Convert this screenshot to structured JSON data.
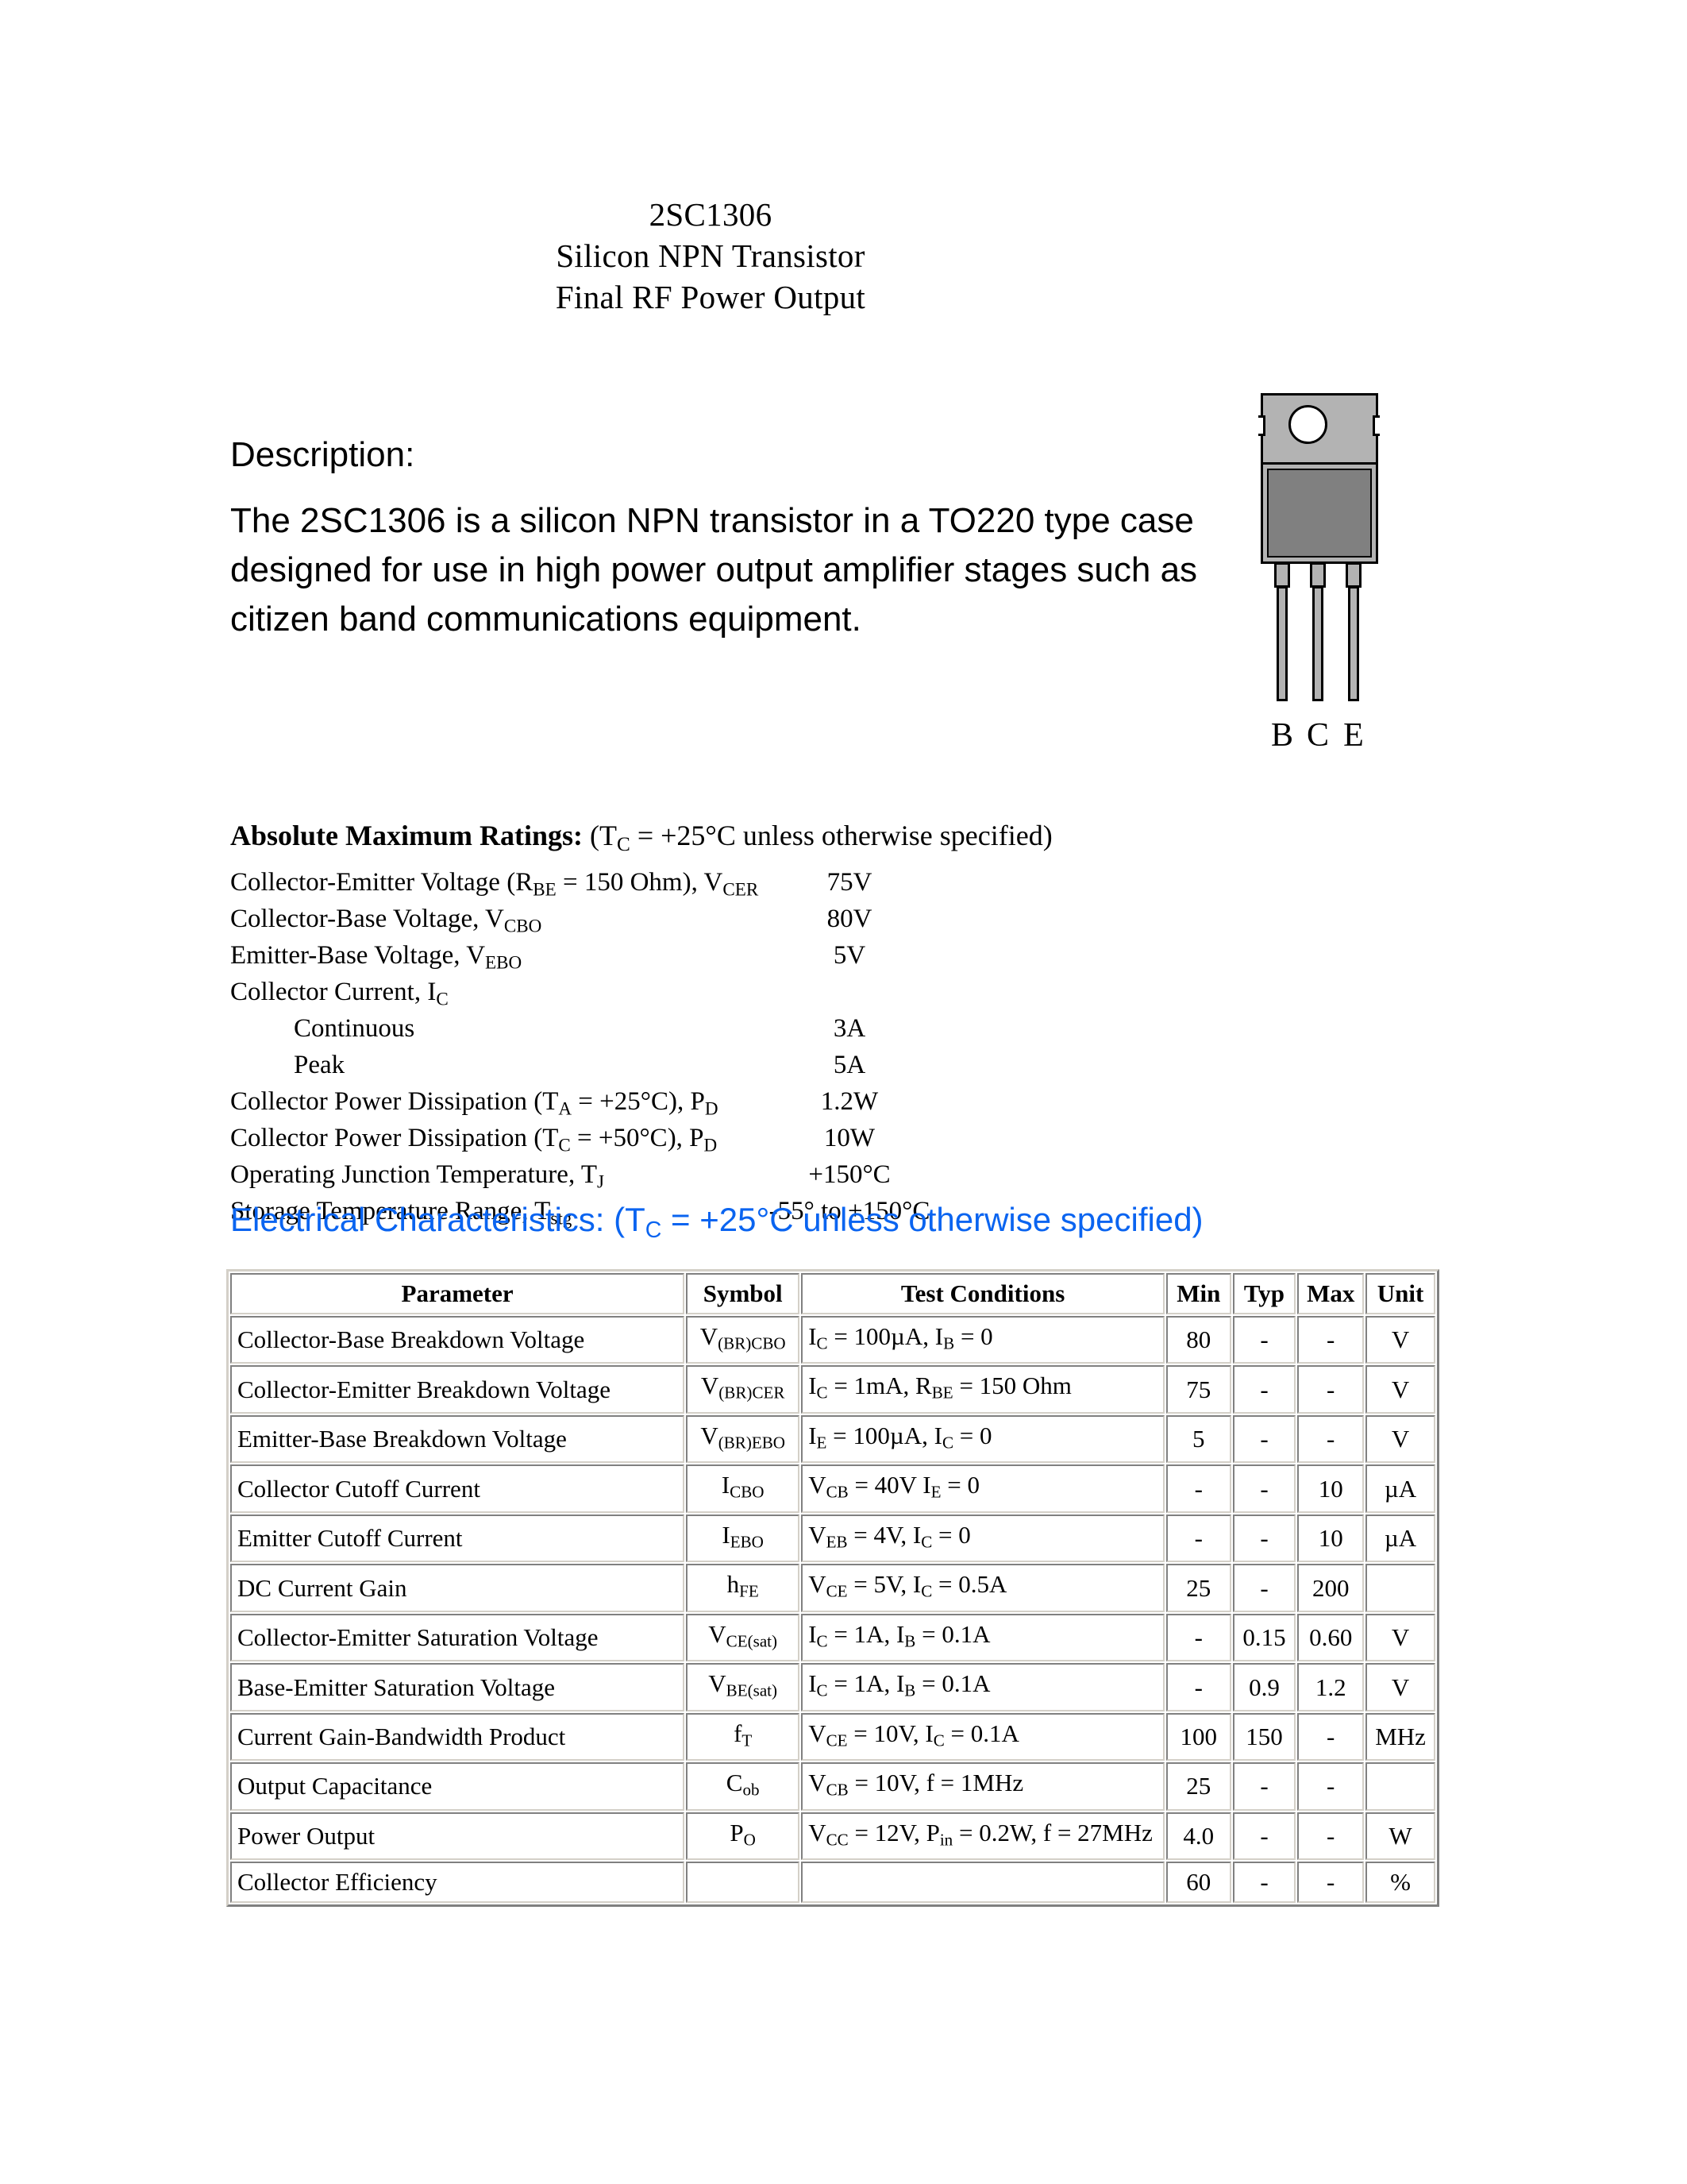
{
  "title": {
    "line1": "2SC1306",
    "line2": "Silicon NPN Transistor",
    "line3": "Final RF Power Output"
  },
  "description": {
    "heading": "Description:",
    "body": "The 2SC1306 is a silicon NPN transistor in a TO220 type case designed for use in high power output amplifier stages such as citizen band communications equipment."
  },
  "package": {
    "type": "TO220",
    "pins": [
      "B",
      "C",
      "E"
    ],
    "colors": {
      "tab": "#b3b3b3",
      "body": "#808080",
      "lead": "#b3b3b3",
      "outline": "#000000"
    }
  },
  "absolute_maximum_ratings": {
    "heading_bold": "Absolute Maximum Ratings:",
    "heading_cond_pre": " (T",
    "heading_cond_sub": "C",
    "heading_cond_post": " = +25°C unless otherwise specified)",
    "rows": [
      {
        "label_pre": "Collector-Emitter Voltage (R",
        "sub1": "BE",
        "label_mid": " = 150 Ohm), V",
        "sub2": "CER",
        "label_post": "",
        "value": "75V",
        "indent": false
      },
      {
        "label_pre": "Collector-Base Voltage, V",
        "sub1": "CBO",
        "label_mid": "",
        "sub2": "",
        "label_post": "",
        "value": "80V",
        "indent": false
      },
      {
        "label_pre": "Emitter-Base Voltage, V",
        "sub1": "EBO",
        "label_mid": "",
        "sub2": "",
        "label_post": "",
        "value": "5V",
        "indent": false
      },
      {
        "label_pre": "Collector Current, I",
        "sub1": "C",
        "label_mid": "",
        "sub2": "",
        "label_post": "",
        "value": "",
        "indent": false
      },
      {
        "label_pre": "Continuous",
        "sub1": "",
        "label_mid": "",
        "sub2": "",
        "label_post": "",
        "value": "3A",
        "indent": true
      },
      {
        "label_pre": "Peak",
        "sub1": "",
        "label_mid": "",
        "sub2": "",
        "label_post": "",
        "value": "5A",
        "indent": true
      },
      {
        "label_pre": "Collector Power Dissipation (T",
        "sub1": "A",
        "label_mid": " = +25°C), P",
        "sub2": "D",
        "label_post": "",
        "value": "1.2W",
        "indent": false
      },
      {
        "label_pre": "Collector Power Dissipation (T",
        "sub1": "C",
        "label_mid": " = +50°C), P",
        "sub2": "D",
        "label_post": "",
        "value": "10W",
        "indent": false
      },
      {
        "label_pre": "Operating Junction Temperature, T",
        "sub1": "J",
        "label_mid": "",
        "sub2": "",
        "label_post": "",
        "value": "+150°C",
        "indent": false
      },
      {
        "label_pre": "Storage Temperature Range, T",
        "sub1": "stg",
        "label_mid": "",
        "sub2": "",
        "label_post": "",
        "value": "-55° to +150°C",
        "indent": false,
        "wide": true
      }
    ]
  },
  "electrical_characteristics": {
    "heading_pre": "Electrical Characteristics: (T",
    "heading_sub": "C",
    "heading_post": " = +25°C unless otherwise specified)",
    "heading_color": "#0a64f0",
    "columns": [
      "Parameter",
      "Symbol",
      "Test Conditions",
      "Min",
      "Typ",
      "Max",
      "Unit"
    ],
    "rows": [
      {
        "parameter": "Collector-Base Breakdown Voltage",
        "symbol": [
          {
            "t": "V"
          },
          {
            "t": "(BR)CBO",
            "sub": true
          }
        ],
        "conditions": [
          {
            "t": "I"
          },
          {
            "t": "C",
            "sub": true
          },
          {
            "t": " = 100µA, I"
          },
          {
            "t": "B",
            "sub": true
          },
          {
            "t": " = 0"
          }
        ],
        "min": "80",
        "typ": "-",
        "max": "-",
        "unit": "V"
      },
      {
        "parameter": "Collector-Emitter Breakdown Voltage",
        "symbol": [
          {
            "t": "V"
          },
          {
            "t": "(BR)CER",
            "sub": true
          }
        ],
        "conditions": [
          {
            "t": "I"
          },
          {
            "t": "C",
            "sub": true
          },
          {
            "t": " = 1mA, R"
          },
          {
            "t": "BE",
            "sub": true
          },
          {
            "t": " = 150 Ohm"
          }
        ],
        "min": "75",
        "typ": "-",
        "max": "-",
        "unit": "V"
      },
      {
        "parameter": "Emitter-Base Breakdown Voltage",
        "symbol": [
          {
            "t": "V"
          },
          {
            "t": "(BR)EBO",
            "sub": true
          }
        ],
        "conditions": [
          {
            "t": "I"
          },
          {
            "t": "E",
            "sub": true
          },
          {
            "t": " = 100µA, I"
          },
          {
            "t": "C",
            "sub": true
          },
          {
            "t": " = 0"
          }
        ],
        "min": "5",
        "typ": "-",
        "max": "-",
        "unit": "V"
      },
      {
        "parameter": "Collector Cutoff Current",
        "symbol": [
          {
            "t": "I"
          },
          {
            "t": "CBO",
            "sub": true
          }
        ],
        "conditions": [
          {
            "t": "V"
          },
          {
            "t": "CB",
            "sub": true
          },
          {
            "t": " = 40V I"
          },
          {
            "t": "E",
            "sub": true
          },
          {
            "t": " = 0"
          }
        ],
        "min": "-",
        "typ": "-",
        "max": "10",
        "unit": "µA"
      },
      {
        "parameter": "Emitter Cutoff Current",
        "symbol": [
          {
            "t": "I"
          },
          {
            "t": "EBO",
            "sub": true
          }
        ],
        "conditions": [
          {
            "t": "V"
          },
          {
            "t": "EB",
            "sub": true
          },
          {
            "t": " = 4V, I"
          },
          {
            "t": "C",
            "sub": true
          },
          {
            "t": " = 0"
          }
        ],
        "min": "-",
        "typ": "-",
        "max": "10",
        "unit": "µA"
      },
      {
        "parameter": "DC Current Gain",
        "symbol": [
          {
            "t": "h"
          },
          {
            "t": "FE",
            "sub": true
          }
        ],
        "conditions": [
          {
            "t": "V"
          },
          {
            "t": "CE",
            "sub": true
          },
          {
            "t": " = 5V, I"
          },
          {
            "t": "C",
            "sub": true
          },
          {
            "t": " = 0.5A"
          }
        ],
        "min": "25",
        "typ": "-",
        "max": "200",
        "unit": ""
      },
      {
        "parameter": "Collector-Emitter Saturation Voltage",
        "symbol": [
          {
            "t": "V"
          },
          {
            "t": "CE(sat)",
            "sub": true
          }
        ],
        "conditions": [
          {
            "t": "I"
          },
          {
            "t": "C",
            "sub": true
          },
          {
            "t": " = 1A, I"
          },
          {
            "t": "B",
            "sub": true
          },
          {
            "t": " = 0.1A"
          }
        ],
        "min": "-",
        "typ": "0.15",
        "max": "0.60",
        "unit": "V"
      },
      {
        "parameter": "Base-Emitter Saturation Voltage",
        "symbol": [
          {
            "t": "V"
          },
          {
            "t": "BE(sat)",
            "sub": true
          }
        ],
        "conditions": [
          {
            "t": "I"
          },
          {
            "t": "C",
            "sub": true
          },
          {
            "t": " = 1A, I"
          },
          {
            "t": "B",
            "sub": true
          },
          {
            "t": " = 0.1A"
          }
        ],
        "min": "-",
        "typ": "0.9",
        "max": "1.2",
        "unit": "V"
      },
      {
        "parameter": "Current Gain-Bandwidth Product",
        "symbol": [
          {
            "t": "f"
          },
          {
            "t": "T",
            "sub": true
          }
        ],
        "conditions": [
          {
            "t": "V"
          },
          {
            "t": "CE",
            "sub": true
          },
          {
            "t": " = 10V, I"
          },
          {
            "t": "C",
            "sub": true
          },
          {
            "t": " = 0.1A"
          }
        ],
        "min": "100",
        "typ": "150",
        "max": "-",
        "unit": "MHz"
      },
      {
        "parameter": "Output Capacitance",
        "symbol": [
          {
            "t": "C"
          },
          {
            "t": "ob",
            "sub": true
          }
        ],
        "conditions": [
          {
            "t": "V"
          },
          {
            "t": "CB",
            "sub": true
          },
          {
            "t": " = 10V, f = 1MHz"
          }
        ],
        "min": "25",
        "typ": "-",
        "max": "-",
        "unit": ""
      },
      {
        "parameter": "Power Output",
        "symbol": [
          {
            "t": "P"
          },
          {
            "t": "O",
            "sub": true
          }
        ],
        "conditions": [
          {
            "t": "V"
          },
          {
            "t": "CC",
            "sub": true
          },
          {
            "t": " = 12V, P"
          },
          {
            "t": "in",
            "sub": true
          },
          {
            "t": " = 0.2W, f = 27MHz"
          }
        ],
        "min": "4.0",
        "typ": "-",
        "max": "-",
        "unit": "W"
      },
      {
        "parameter": "Collector Efficiency",
        "symbol": [],
        "conditions": [],
        "min": "60",
        "typ": "-",
        "max": "-",
        "unit": "%"
      }
    ]
  }
}
